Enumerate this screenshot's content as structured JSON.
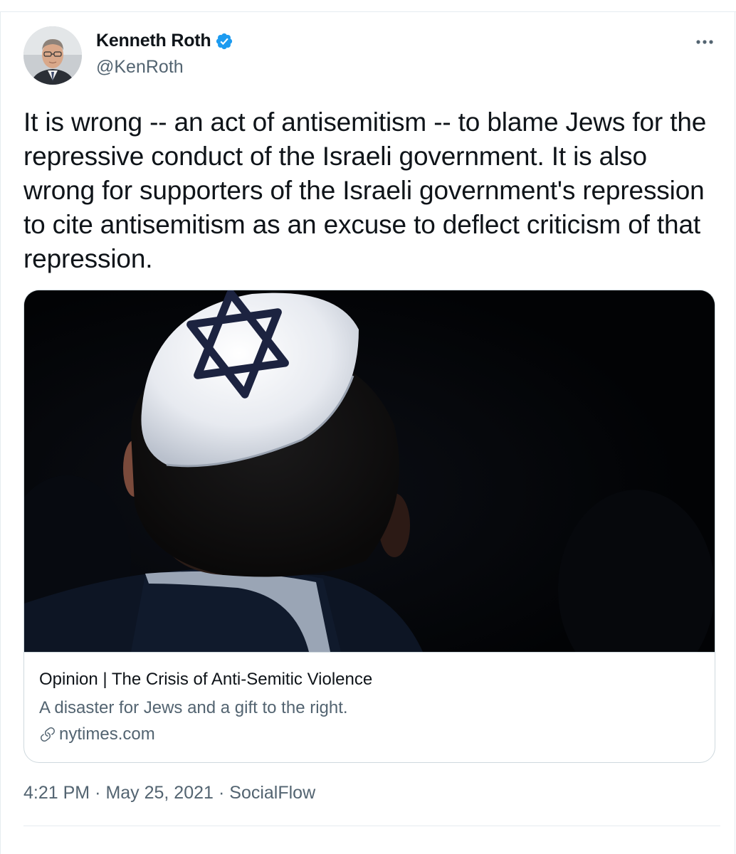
{
  "tweet": {
    "author": {
      "display_name": "Kenneth Roth",
      "handle": "@KenRoth",
      "verified": true,
      "verified_color": "#1d9bf0"
    },
    "text": "It is wrong -- an act of antisemitism -- to blame Jews for the repressive conduct of the Israeli government. It is also wrong for supporters of the Israeli government's repression to cite antisemitism as an excuse to deflect criticism of that repression.",
    "link_card": {
      "title": "Opinion | The Crisis of Anti-Semitic Violence",
      "description": "A disaster for Jews and a gift to the right.",
      "domain": "nytimes.com",
      "image_icon": "kippah-star-of-david-photo"
    },
    "time": "4:21 PM",
    "date": "May 25, 2021",
    "source": "SocialFlow",
    "separator": "·"
  },
  "icons": {
    "more": "more-icon",
    "verified": "verified-badge-icon",
    "link": "link-icon"
  },
  "colors": {
    "text_primary": "#0f1419",
    "text_secondary": "#536471",
    "border": "#cfd9de",
    "verified_blue": "#1d9bf0"
  }
}
